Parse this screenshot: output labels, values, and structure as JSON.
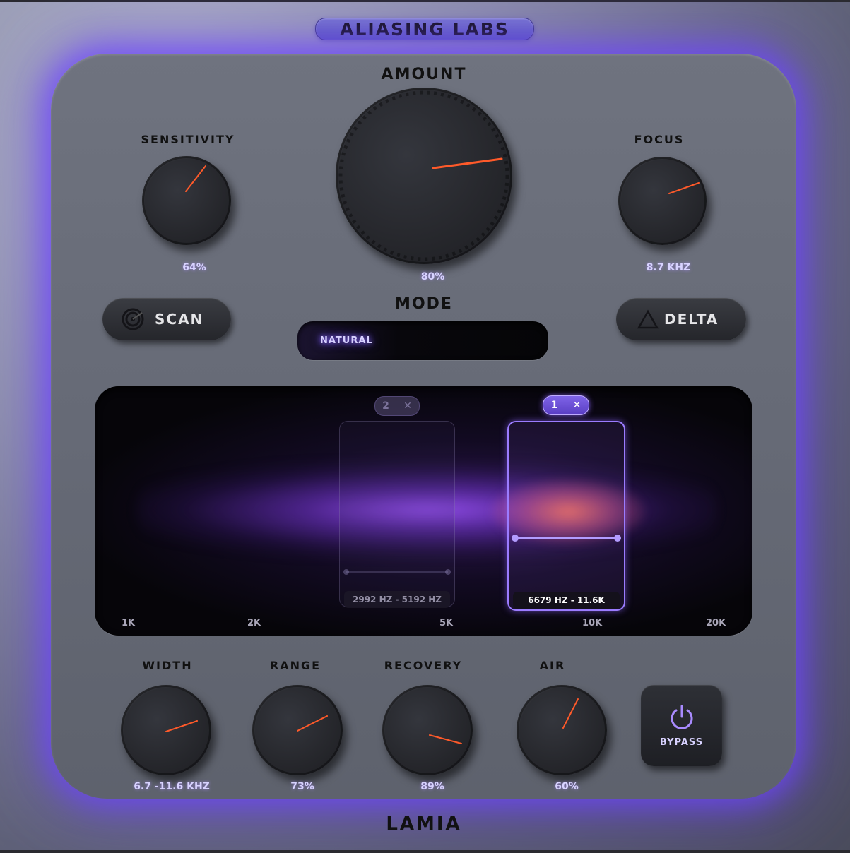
{
  "brand": "ALIASING LABS",
  "product": "LAMIA",
  "accent_color": "#8b5cf6",
  "indicator_color": "#ff5a2a",
  "knobs": {
    "amount": {
      "label": "AMOUNT",
      "value": "80%"
    },
    "sensitivity": {
      "label": "SENSITIVITY",
      "value": "64%"
    },
    "focus": {
      "label": "FOCUS",
      "value": "8.7 KHZ"
    },
    "width": {
      "label": "WIDTH",
      "value": "6.7 -11.6 KHZ"
    },
    "range": {
      "label": "RANGE",
      "value": "73%"
    },
    "recovery": {
      "label": "RECOVERY",
      "value": "89%"
    },
    "air": {
      "label": "AIR",
      "value": "60%"
    }
  },
  "buttons": {
    "scan": {
      "label": "SCAN",
      "icon": "radar-icon"
    },
    "delta": {
      "label": "DELTA",
      "icon": "triangle-icon"
    },
    "bypass": {
      "label": "BYPASS",
      "icon": "power-icon"
    }
  },
  "mode": {
    "label": "MODE",
    "selected": "NATURAL"
  },
  "spectrum": {
    "freq_labels": [
      "1K",
      "2K",
      "5K",
      "10K",
      "20K"
    ],
    "bands": [
      {
        "id": "2",
        "range": "2992 HZ - 5192 HZ",
        "active": false
      },
      {
        "id": "1",
        "range": "6679 HZ - 11.6K",
        "active": true
      }
    ],
    "close_glyph": "✕"
  }
}
